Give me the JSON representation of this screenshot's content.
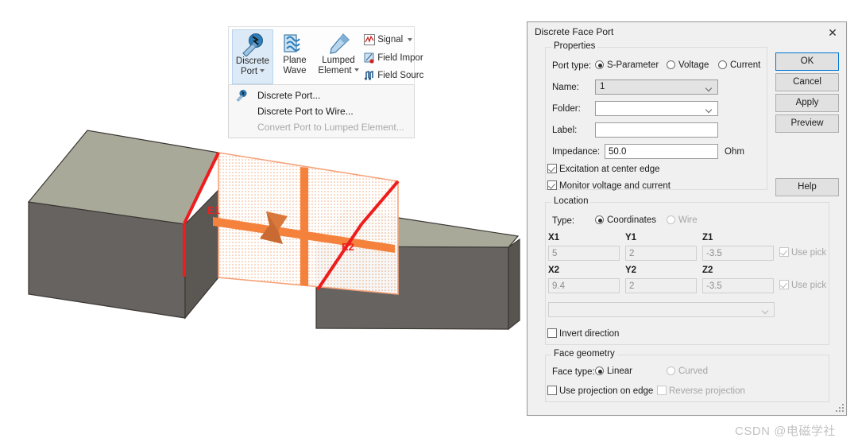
{
  "ribbon": {
    "buttons": [
      {
        "id": "discrete-port",
        "line1": "Discrete",
        "line2": "Port",
        "icon": "discrete-port-icon",
        "has_caret": true,
        "active": true
      },
      {
        "id": "plane-wave",
        "line1": "Plane",
        "line2": "Wave",
        "icon": "plane-wave-icon",
        "has_caret": false,
        "active": false
      },
      {
        "id": "lumped-element",
        "line1": "Lumped",
        "line2": "Element",
        "icon": "lumped-element-icon",
        "has_caret": true,
        "active": false
      }
    ],
    "small_items": [
      {
        "id": "signal",
        "label": "Signal",
        "icon": "signal-icon",
        "has_caret": true
      },
      {
        "id": "field-import",
        "label": "Field Impor",
        "icon": "field-import-icon",
        "has_caret": false
      },
      {
        "id": "field-source",
        "label": "Field Sourc",
        "icon": "field-source-icon",
        "has_caret": false
      }
    ]
  },
  "menu": {
    "items": [
      {
        "label": "Discrete Port...",
        "disabled": false,
        "icon": "discrete-port-icon"
      },
      {
        "label": "Discrete Port to Wire...",
        "disabled": false,
        "icon": ""
      },
      {
        "label": "Convert Port to Lumped Element...",
        "disabled": true,
        "icon": ""
      }
    ]
  },
  "dialog": {
    "title": "Discrete Face Port",
    "close_icon": "close-icon",
    "properties": {
      "group_title": "Properties",
      "port_type_label": "Port type:",
      "port_type_options": [
        {
          "label": "S-Parameter",
          "selected": true
        },
        {
          "label": "Voltage",
          "selected": false
        },
        {
          "label": "Current",
          "selected": false
        }
      ],
      "name_label": "Name:",
      "name_value": "1",
      "folder_label": "Folder:",
      "folder_value": "",
      "label_label": "Label:",
      "label_value": "",
      "impedance_label": "Impedance:",
      "impedance_value": "50.0",
      "impedance_unit": "Ohm",
      "excitation_checkbox": {
        "label": "Excitation at center edge",
        "checked": true
      },
      "monitor_checkbox": {
        "label": "Monitor voltage and current",
        "checked": true
      }
    },
    "location": {
      "group_title": "Location",
      "type_label": "Type:",
      "type_options": [
        {
          "label": "Coordinates",
          "selected": true,
          "disabled": false
        },
        {
          "label": "Wire",
          "selected": false,
          "disabled": true
        }
      ],
      "coord_headers_row1": [
        "X1",
        "Y1",
        "Z1"
      ],
      "coord_values_row1": [
        "5",
        "2",
        "-3.5"
      ],
      "coord_headers_row2": [
        "X2",
        "Y2",
        "Z2"
      ],
      "coord_values_row2": [
        "9.4",
        "2",
        "-3.5"
      ],
      "use_pick_row1": {
        "label": "Use pick",
        "checked": true,
        "disabled": true
      },
      "use_pick_row2": {
        "label": "Use pick",
        "checked": true,
        "disabled": true
      },
      "extra_combo_value": "",
      "invert_direction": {
        "label": "Invert direction",
        "checked": false
      }
    },
    "face_geometry": {
      "group_title": "Face geometry",
      "face_type_label": "Face type:",
      "face_type_options": [
        {
          "label": "Linear",
          "selected": true,
          "disabled": false
        },
        {
          "label": "Curved",
          "selected": false,
          "disabled": true
        }
      ],
      "use_projection": {
        "label": "Use projection on edge",
        "checked": false,
        "disabled": false
      },
      "reverse_projection": {
        "label": "Reverse projection",
        "checked": false,
        "disabled": true
      }
    },
    "buttons": [
      {
        "id": "ok",
        "label": "OK",
        "default": true
      },
      {
        "id": "cancel",
        "label": "Cancel",
        "default": false
      },
      {
        "id": "apply",
        "label": "Apply",
        "default": false
      },
      {
        "id": "preview",
        "label": "Preview",
        "default": false
      },
      {
        "id": "help",
        "label": "Help",
        "default": false
      }
    ]
  },
  "viewport": {
    "edge_label_1": "E1",
    "edge_label_2": "E2",
    "colors": {
      "port_orange": "#f07a35",
      "edge_red": "#ee1c1c",
      "box_top": "#a9a99a",
      "box_front": "#676360",
      "box_side": "#585450"
    }
  },
  "watermark": {
    "text": "CSDN @电磁学社"
  }
}
